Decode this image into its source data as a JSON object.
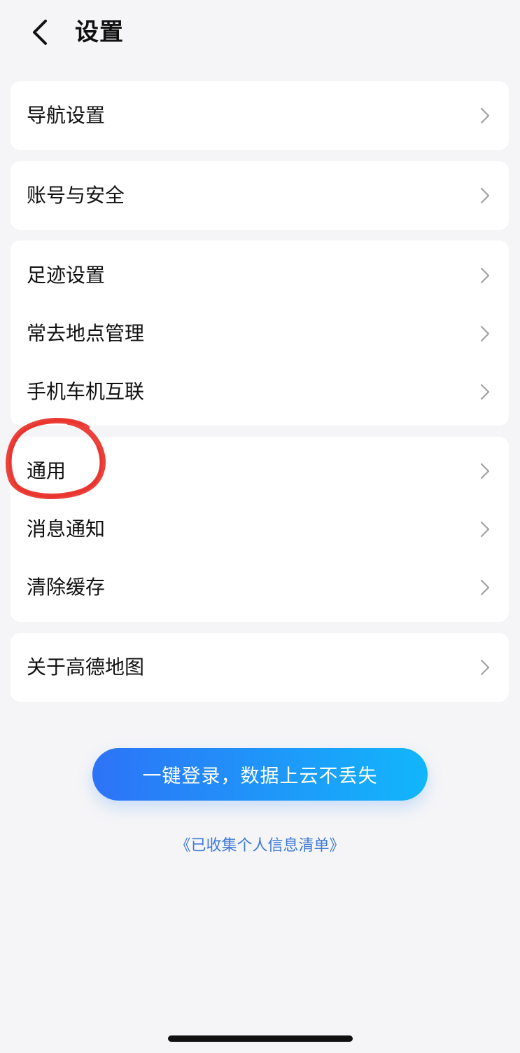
{
  "header": {
    "title": "设置"
  },
  "cards": [
    {
      "items": [
        {
          "label": "导航设置"
        }
      ]
    },
    {
      "items": [
        {
          "label": "账号与安全"
        }
      ]
    },
    {
      "items": [
        {
          "label": "足迹设置"
        },
        {
          "label": "常去地点管理"
        },
        {
          "label": "手机车机互联"
        }
      ]
    },
    {
      "items": [
        {
          "label": "通用"
        },
        {
          "label": "消息通知"
        },
        {
          "label": "清除缓存"
        }
      ]
    },
    {
      "items": [
        {
          "label": "关于高德地图"
        }
      ]
    }
  ],
  "login_button": {
    "label": "一键登录，数据上云不丢失"
  },
  "privacy_link": {
    "label": "《已收集个人信息清单》"
  },
  "colors": {
    "background": "#f5f5f7",
    "card": "#ffffff",
    "button_gradient_start": "#2d73f7",
    "button_gradient_end": "#12b6fb",
    "link": "#3f7ad6",
    "annotation": "#e8322a"
  },
  "icons": {
    "back": "chevron-left-icon",
    "row_arrow": "chevron-right-icon"
  }
}
